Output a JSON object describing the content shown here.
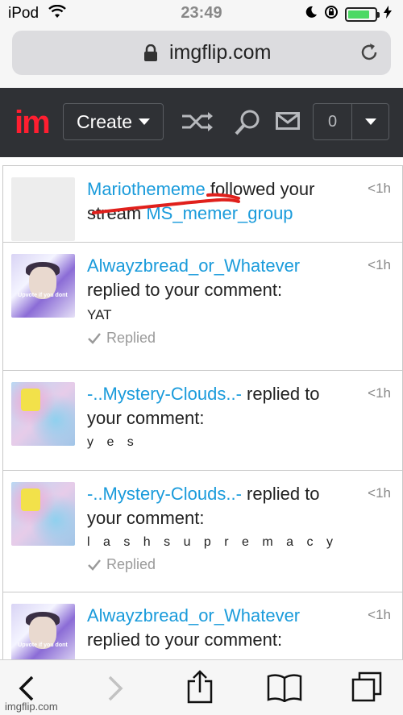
{
  "status_bar": {
    "carrier": "iPod",
    "time": "23:49"
  },
  "browser": {
    "url": "imgflip.com"
  },
  "nav": {
    "logo": "im",
    "create_label": "Create",
    "notification_count": "0"
  },
  "notifications": [
    {
      "user": "Mariothememe",
      "action": " followed your stream ",
      "target": "MS_memer_group",
      "time": "<1h"
    },
    {
      "user": "Alwayzbread_or_Whatever",
      "action": " replied to your comment:",
      "comment": "YAT",
      "status": "Replied",
      "time": "<1h",
      "avatar_text": "Upvote if you dont"
    },
    {
      "user": "-..Mystery-Clouds..-",
      "action": " replied to your comment:",
      "comment": "y e s",
      "time": "<1h"
    },
    {
      "user": "-..Mystery-Clouds..-",
      "action": " replied to your comment:",
      "comment": "l a s h s u p r e m a c y",
      "status": "Replied",
      "time": "<1h"
    },
    {
      "user": "Alwayzbread_or_Whatever",
      "action": " replied to your comment:",
      "time": "<1h",
      "avatar_text": "Upvote if you dont"
    }
  ],
  "watermark": "imgflip.com",
  "icons": {
    "wifi": "wifi-icon",
    "lock": "lock-icon",
    "reload": "reload-icon",
    "shuffle": "shuffle-icon",
    "search": "search-icon",
    "mail": "mail-icon",
    "back": "back-icon",
    "forward": "forward-icon",
    "share": "share-icon",
    "bookmarks": "bookmarks-icon",
    "tabs": "tabs-icon"
  },
  "colors": {
    "link": "#1a9bdb",
    "nav_bg": "#2f3135",
    "logo": "#ff1e30",
    "battery": "#4cd964"
  }
}
